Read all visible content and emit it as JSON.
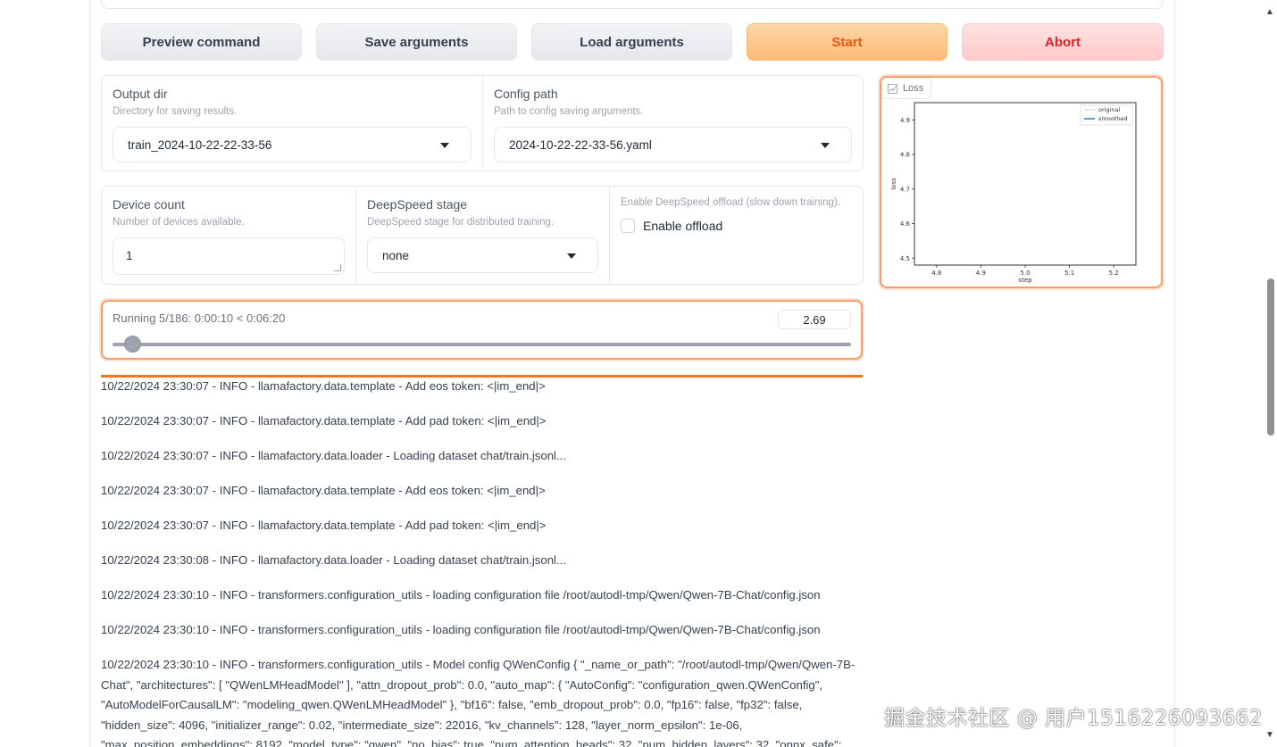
{
  "toolbar": {
    "preview_label": "Preview command",
    "save_label": "Save arguments",
    "load_label": "Load arguments",
    "start_label": "Start",
    "abort_label": "Abort"
  },
  "output_dir": {
    "label": "Output dir",
    "info": "Directory for saving results.",
    "value": "train_2024-10-22-22-33-56"
  },
  "config_path": {
    "label": "Config path",
    "info": "Path to config saving arguments.",
    "value": "2024-10-22-22-33-56.yaml"
  },
  "device_count": {
    "label": "Device count",
    "info": "Number of devices available.",
    "value": "1"
  },
  "deepspeed_stage": {
    "label": "DeepSpeed stage",
    "info": "DeepSpeed stage for distributed training.",
    "value": "none"
  },
  "offload": {
    "info": "Enable DeepSpeed offload (slow down training).",
    "label": "Enable offload",
    "checked": false
  },
  "progress": {
    "label": "Running 5/186: 0:00:10 < 0:06:20",
    "value": "2.69",
    "fraction": 0.0269
  },
  "loss_plot": {
    "tab_label": "Loss",
    "chart_data": {
      "type": "line",
      "xlabel": "step",
      "ylabel": "loss",
      "x_ticks": [
        "4.8",
        "4.9",
        "5.0",
        "5.1",
        "5.2"
      ],
      "y_ticks": [
        "4.5",
        "4.6",
        "4.7",
        "4.8",
        "4.9"
      ],
      "xlim": [
        4.75,
        5.25
      ],
      "ylim": [
        4.48,
        4.95
      ],
      "series": [
        {
          "name": "original",
          "color": "#cfe2f3",
          "x": [],
          "y": []
        },
        {
          "name": "smoothed",
          "color": "#1f77b4",
          "x": [],
          "y": []
        }
      ],
      "legend": "top-right"
    }
  },
  "logs": [
    "10/22/2024 23:30:07 - INFO - llamafactory.data.template - Add eos token: <|im_end|>",
    "10/22/2024 23:30:07 - INFO - llamafactory.data.template - Add pad token: <|im_end|>",
    "10/22/2024 23:30:07 - INFO - llamafactory.data.loader - Loading dataset chat/train.jsonl...",
    "10/22/2024 23:30:07 - INFO - llamafactory.data.template - Add eos token: <|im_end|>",
    "10/22/2024 23:30:07 - INFO - llamafactory.data.template - Add pad token: <|im_end|>",
    "10/22/2024 23:30:08 - INFO - llamafactory.data.loader - Loading dataset chat/train.jsonl...",
    "10/22/2024 23:30:10 - INFO - transformers.configuration_utils - loading configuration file /root/autodl-tmp/Qwen/Qwen-7B-Chat/config.json",
    "10/22/2024 23:30:10 - INFO - transformers.configuration_utils - loading configuration file /root/autodl-tmp/Qwen/Qwen-7B-Chat/config.json",
    "10/22/2024 23:30:10 - INFO - transformers.configuration_utils - Model config QWenConfig { \"_name_or_path\": \"/root/autodl-tmp/Qwen/Qwen-7B-Chat\", \"architectures\": [ \"QWenLMHeadModel\" ], \"attn_dropout_prob\": 0.0, \"auto_map\": { \"AutoConfig\": \"configuration_qwen.QWenConfig\", \"AutoModelForCausalLM\": \"modeling_qwen.QWenLMHeadModel\" }, \"bf16\": false, \"emb_dropout_prob\": 0.0, \"fp16\": false, \"fp32\": false, \"hidden_size\": 4096, \"initializer_range\": 0.02, \"intermediate_size\": 22016, \"kv_channels\": 128, \"layer_norm_epsilon\": 1e-06, \"max_position_embeddings\": 8192, \"model_type\": \"qwen\", \"no_bias\": true, \"num_attention_heads\": 32, \"num_hidden_layers\": 32, \"onnx_safe\":"
  ],
  "watermark": "掘金技术社区 @ 用户1516226093662"
}
